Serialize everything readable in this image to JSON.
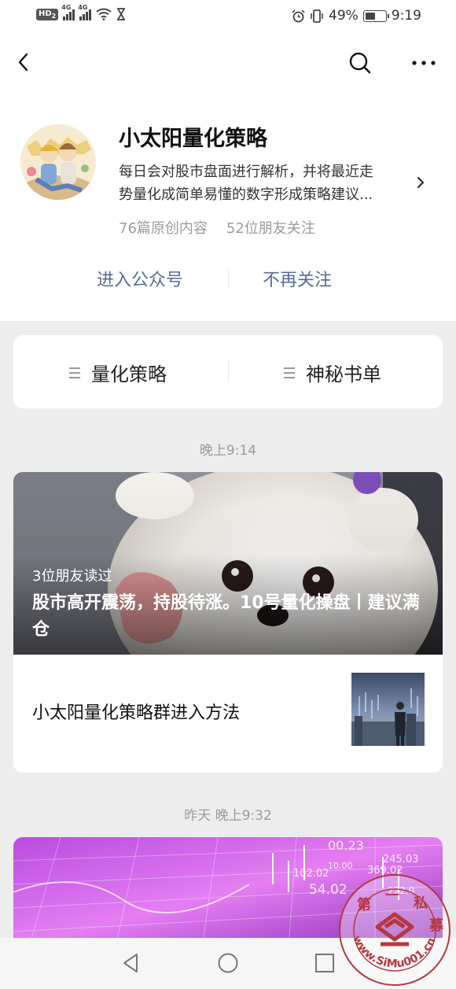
{
  "status_bar": {
    "hd_label": "HD",
    "hd_sub": "2",
    "network_label": "4G",
    "battery_percent": "49%",
    "battery_level": 0.49,
    "time": "9:19"
  },
  "nav": {
    "back_icon": "back-arrow-icon",
    "search_icon": "search-icon",
    "more_icon": "more-dots-icon"
  },
  "account": {
    "name": "小太阳量化策略",
    "description_line1": "每日会对股市盘面进行解析，并将最近走",
    "description_line2": "势量化成简单易懂的数字形成策略建议...",
    "stat_articles": "76篇原创内容",
    "stat_friends": "52位朋友关注",
    "enter_button": "进入公众号",
    "unfollow_button": "不再关注"
  },
  "menu": {
    "items": [
      {
        "label": "量化策略"
      },
      {
        "label": "神秘书单"
      }
    ]
  },
  "feed": [
    {
      "time": "晚上9:14",
      "friends_read": "3位朋友读过",
      "headline": "股市高开震荡，持股待涨。10号量化操盘丨建议满仓",
      "sub_title": "小太阳量化策略群进入方法"
    },
    {
      "time": "昨天 晚上9:32",
      "cover_numbers": [
        "00.23",
        "10.00",
        "245.03",
        "102.02",
        "369.02",
        "54.02",
        "222.0"
      ]
    }
  ],
  "watermark": {
    "chars": [
      "第",
      "一",
      "私",
      "募"
    ],
    "url": "www.SiMu001.cn"
  },
  "colors": {
    "link_blue": "#576b95",
    "background": "#ededed",
    "muted_text": "#9b9b9b"
  }
}
